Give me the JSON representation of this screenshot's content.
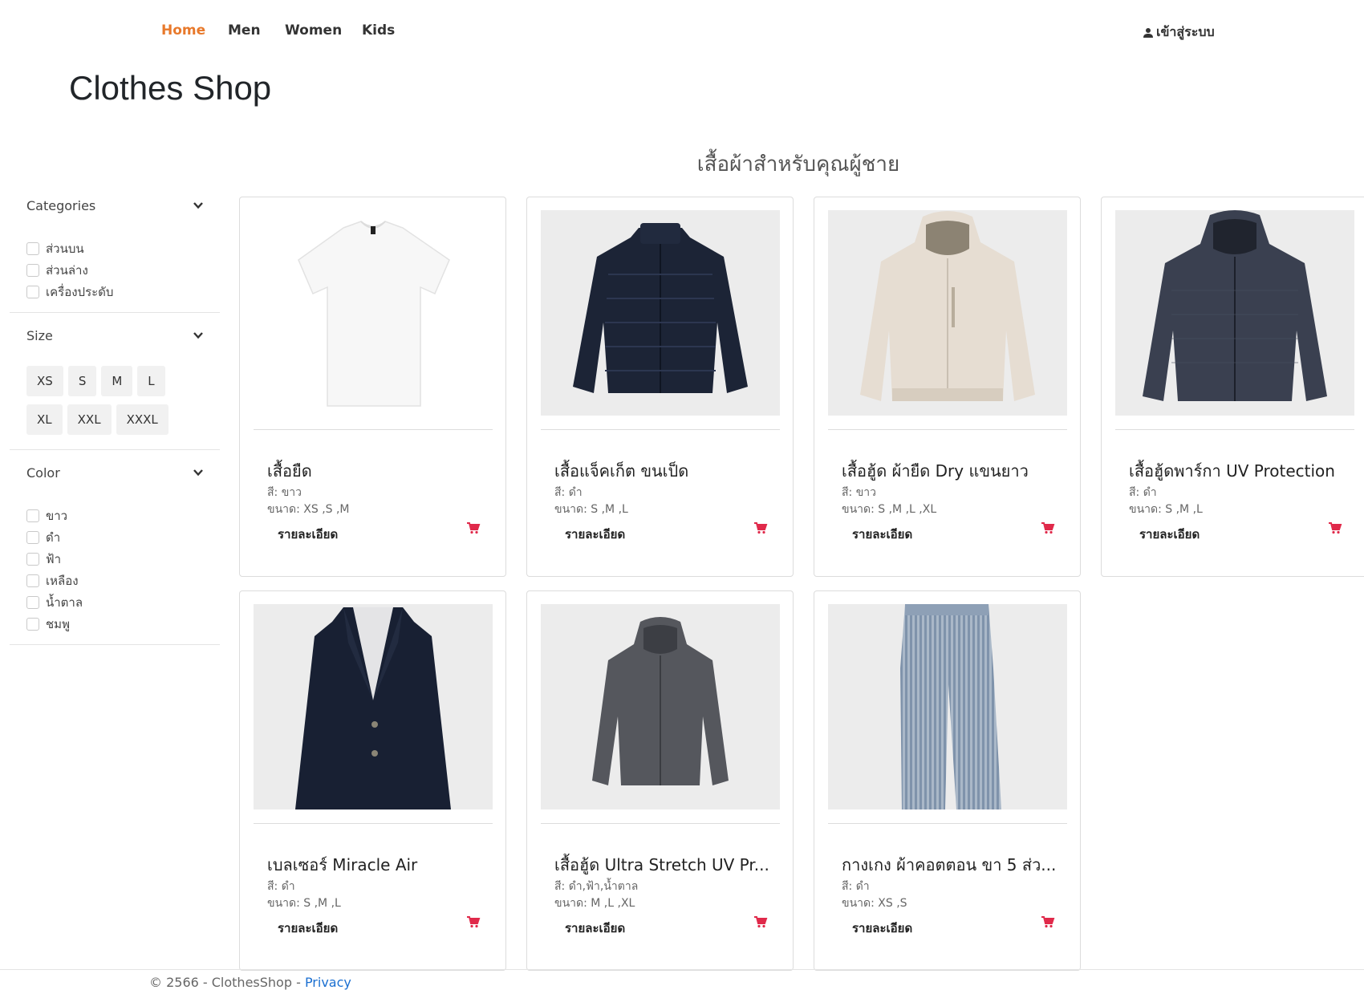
{
  "nav": {
    "items": [
      {
        "label": "Home"
      },
      {
        "label": "Men"
      },
      {
        "label": "Women"
      },
      {
        "label": "Kids"
      }
    ],
    "login_label": "เข้าสู่ระบบ"
  },
  "brand": "Clothes Shop",
  "section_title": "เสื้อผ้าสำหรับคุณผู้ชาย",
  "filters": {
    "categories": {
      "title": "Categories",
      "options": [
        "ส่วนบน",
        "ส่วนล่าง",
        "เครื่องประดับ"
      ]
    },
    "size": {
      "title": "Size",
      "options": [
        "XS",
        "S",
        "M",
        "L",
        "XL",
        "XXL",
        "XXXL"
      ]
    },
    "color": {
      "title": "Color",
      "options": [
        "ขาว",
        "ดำ",
        "ฟ้า",
        "เหลือง",
        "น้ำตาล",
        "ชมพู"
      ]
    }
  },
  "products": [
    {
      "title": "เสื้อยืด",
      "color": "สี: ขาว",
      "size": "ขนาด: XS ,S ,M",
      "detail": "รายละเอียด",
      "image": "white-tshirt"
    },
    {
      "title": "เสื้อแจ็คเก็ต ขนเป็ด",
      "color": "สี: ดำ",
      "size": "ขนาด: S ,M ,L",
      "detail": "รายละเอียด",
      "image": "navy-puffer-jacket"
    },
    {
      "title": "เสื้อฮู้ด ผ้ายืด Dry แขนยาว",
      "color": "สี: ขาว",
      "size": "ขนาด: S ,M ,L ,XL",
      "detail": "รายละเอียด",
      "image": "beige-hoodie"
    },
    {
      "title": "เสื้อฮู้ดพาร์กา UV Protection",
      "color": "สี: ดำ",
      "size": "ขนาด: S ,M ,L",
      "detail": "รายละเอียด",
      "image": "black-parka"
    },
    {
      "title": "เบลเซอร์ Miracle Air",
      "color": "สี: ดำ",
      "size": "ขนาด: S ,M ,L",
      "detail": "รายละเอียด",
      "image": "navy-blazer"
    },
    {
      "title": "เสื้อฮู้ด Ultra Stretch UV Pr...",
      "color": "สี: ดำ,ฟ้า,น้ำตาล",
      "size": "ขนาด: M ,L ,XL",
      "detail": "รายละเอียด",
      "image": "grey-hoodie"
    },
    {
      "title": "กางเกง ผ้าคอตตอน ขา 5 ส่ว...",
      "color": "สี: ดำ",
      "size": "ขนาด: XS ,S",
      "detail": "รายละเอียด",
      "image": "gingham-pants"
    }
  ],
  "footer": {
    "text": "© 2566 - ClothesShop - ",
    "privacy": "Privacy"
  },
  "colors": {
    "nav_active": "#e8792b",
    "cart_icon": "#e0294a",
    "link": "#1a6fd1"
  }
}
